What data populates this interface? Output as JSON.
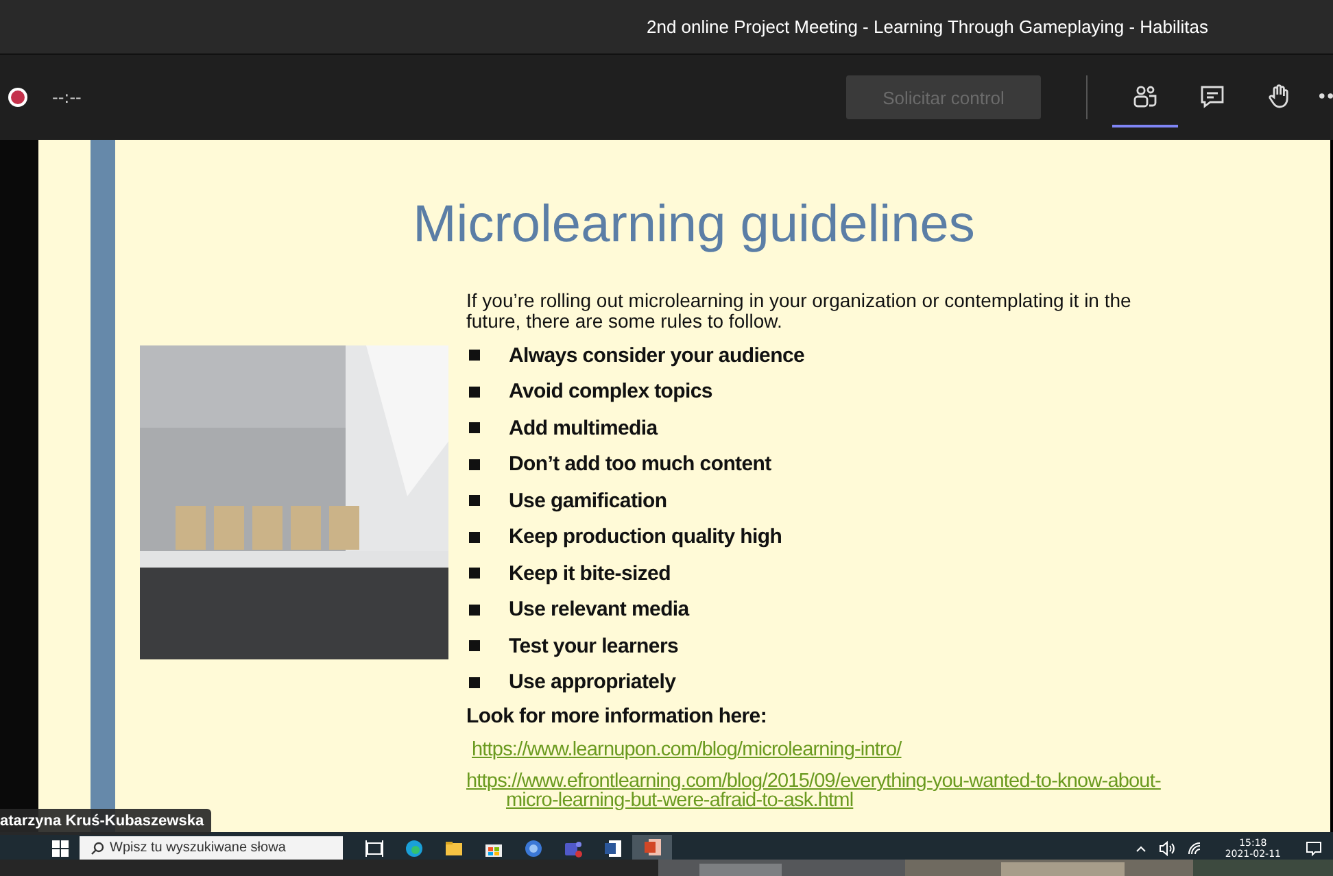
{
  "window": {
    "title": "2nd online Project Meeting - Learning Through Gameplaying - Habilitas"
  },
  "toolbar": {
    "timer": "--:--",
    "request_control": {
      "label": "Solicitar control",
      "disabled": true
    },
    "actions": [
      {
        "kind": "participants",
        "selected": true
      },
      {
        "kind": "chat",
        "selected": false
      },
      {
        "kind": "hand",
        "selected": false
      },
      {
        "kind": "more",
        "selected": false
      }
    ]
  },
  "slide": {
    "title": "Microlearning guidelines",
    "intro": "If you’re rolling out microlearning in your organization or contemplating it in the future, there are some rules to follow.",
    "bullets": [
      "Always consider your audience",
      "Avoid complex topics",
      "Add multimedia",
      "Don’t add too much content",
      "Use gamification",
      "Keep production quality high",
      "Keep it bite-sized",
      "Use relevant media",
      "Test your learners",
      "Use appropriately"
    ],
    "more_info": "Look for more information here:",
    "links": [
      "https://www.learnupon.com/blog/microlearning-intro/",
      "https://www.efrontlearning.com/blog/2015/09/everything-you-wanted-to-know-about-micro-learning-but-were-afraid-to-ask.html"
    ]
  },
  "participant_name": "atarzyna Kruś-Kubaszewska",
  "taskbar": {
    "search": {
      "placeholder": "Wpisz tu wyszukiwane słowa"
    },
    "apps": [
      {
        "kind": "task-view",
        "selected": false
      },
      {
        "kind": "browser",
        "selected": false
      },
      {
        "kind": "folder",
        "selected": false
      },
      {
        "kind": "store",
        "selected": false
      },
      {
        "kind": "app",
        "selected": false
      },
      {
        "kind": "teams",
        "selected": false
      },
      {
        "kind": "word",
        "selected": false
      },
      {
        "kind": "powerpoint",
        "selected": true
      }
    ],
    "time": "15:18",
    "date": "2021-02-11"
  }
}
